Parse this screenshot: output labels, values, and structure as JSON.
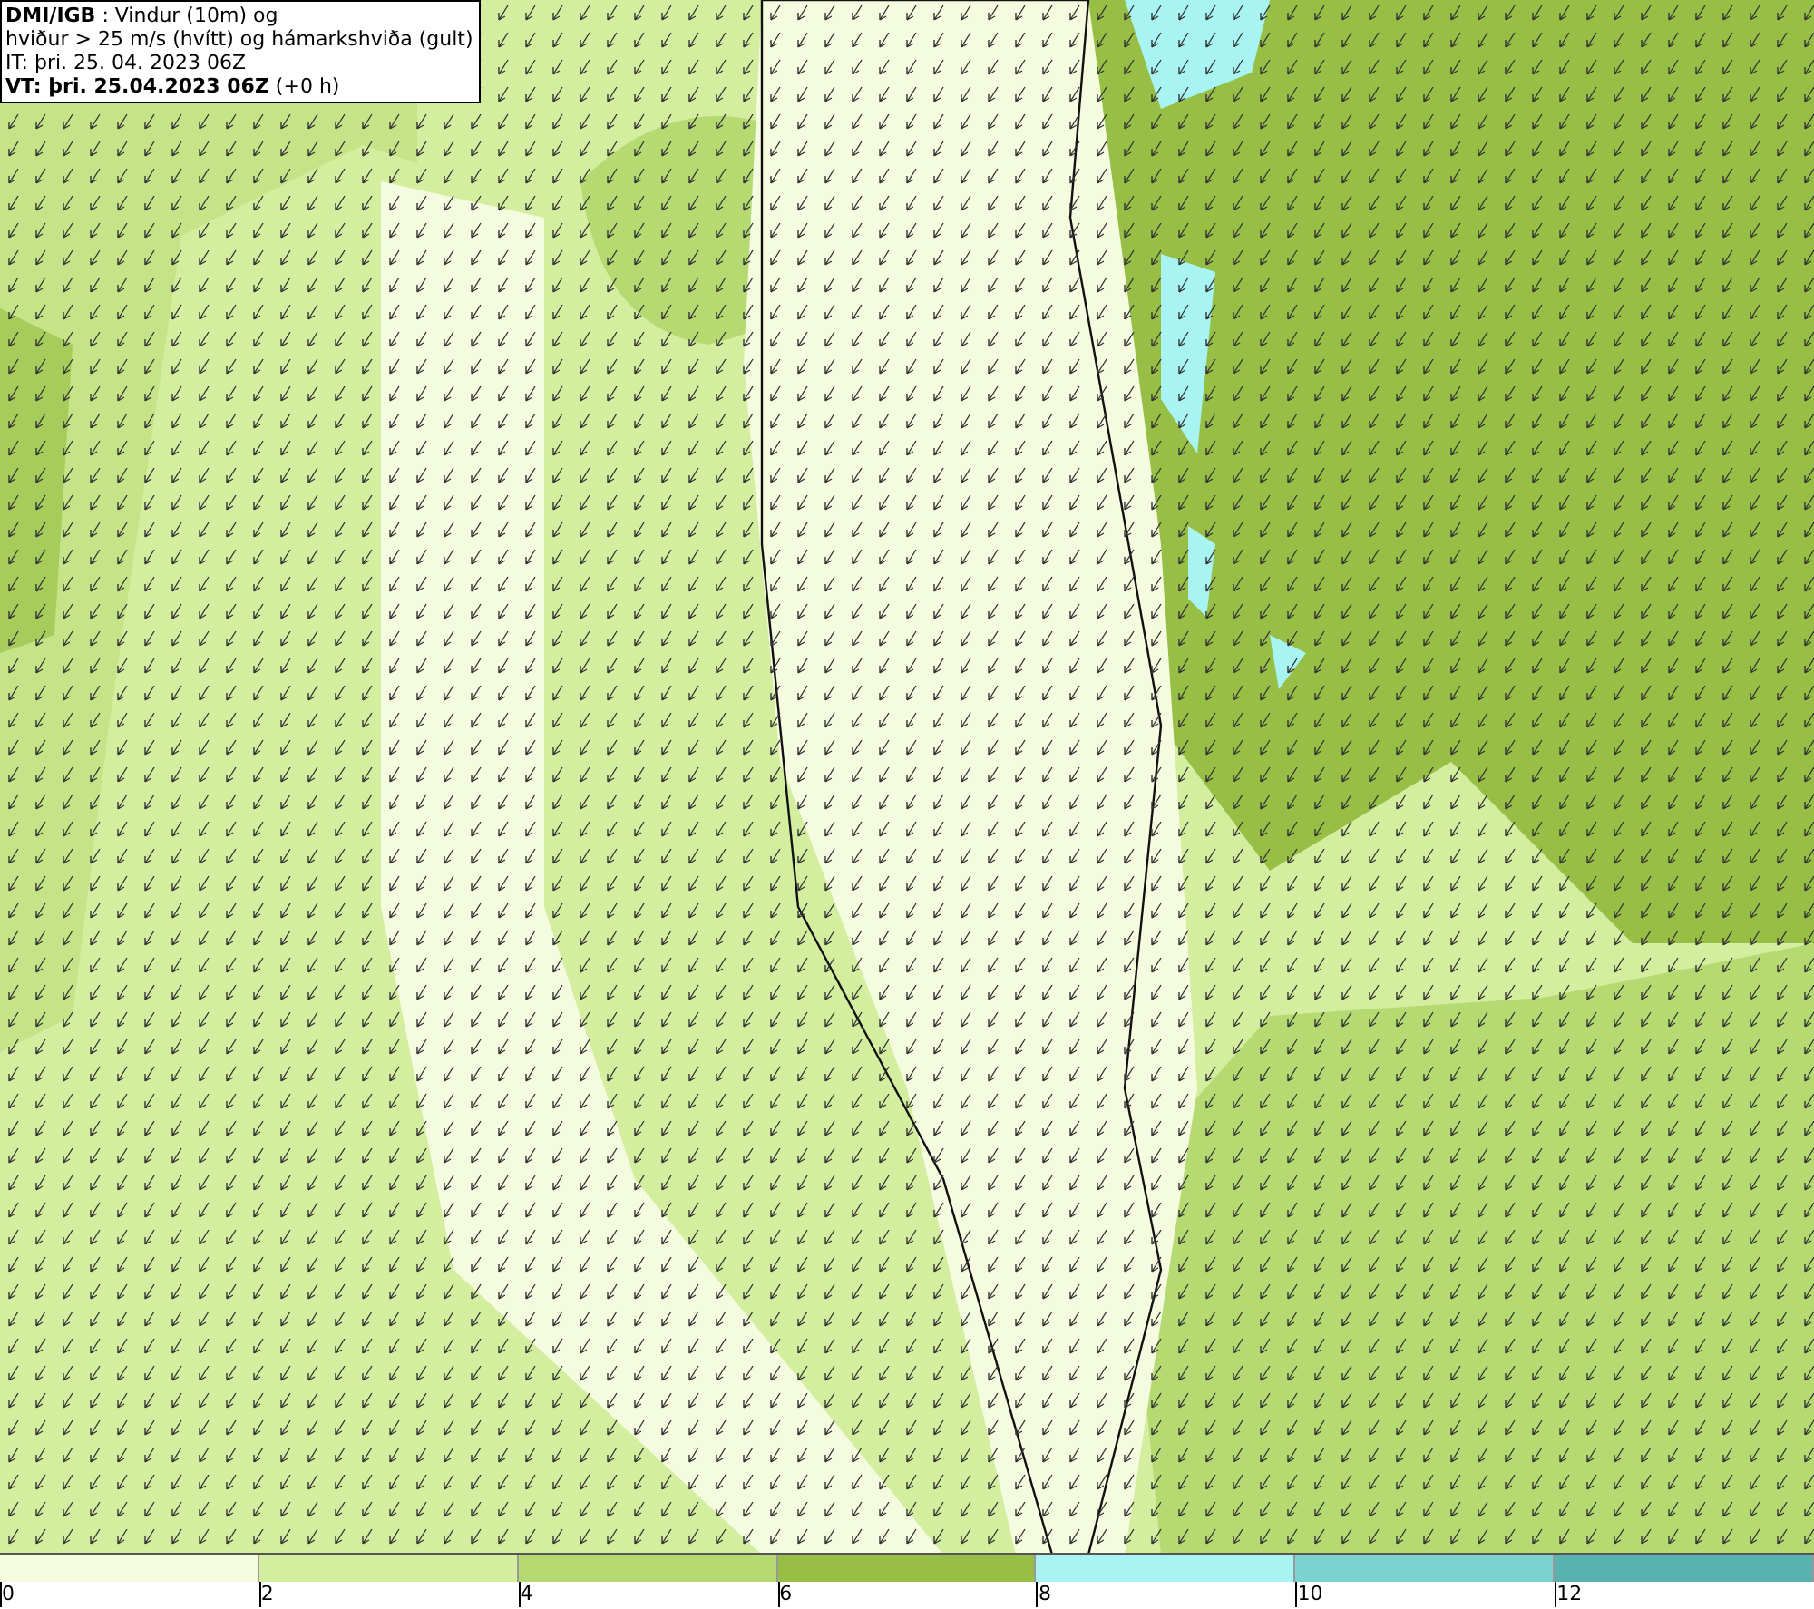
{
  "title_box": {
    "lines": [
      "**DMI/IGB** : Vindur (10m) og",
      "hviður > 25 m/s (hvítt) og hámarkshviða (gult)",
      "IT: þri. 25. 04. 2023 06Z",
      "**VT: þri. 25.04.2023 06Z** (+0 h)"
    ]
  },
  "legend": {
    "bins": [
      {
        "color": "#f4fbdf"
      },
      {
        "color": "#d4ee9f"
      },
      {
        "color": "#b5da72"
      },
      {
        "color": "#97bf45"
      },
      {
        "color": "#a8f4f2"
      },
      {
        "color": "#7bd3d0"
      },
      {
        "color": "#57b2b0"
      }
    ],
    "ticks": [
      "0",
      "2",
      "4",
      "6",
      "8",
      "10",
      "12"
    ]
  }
}
